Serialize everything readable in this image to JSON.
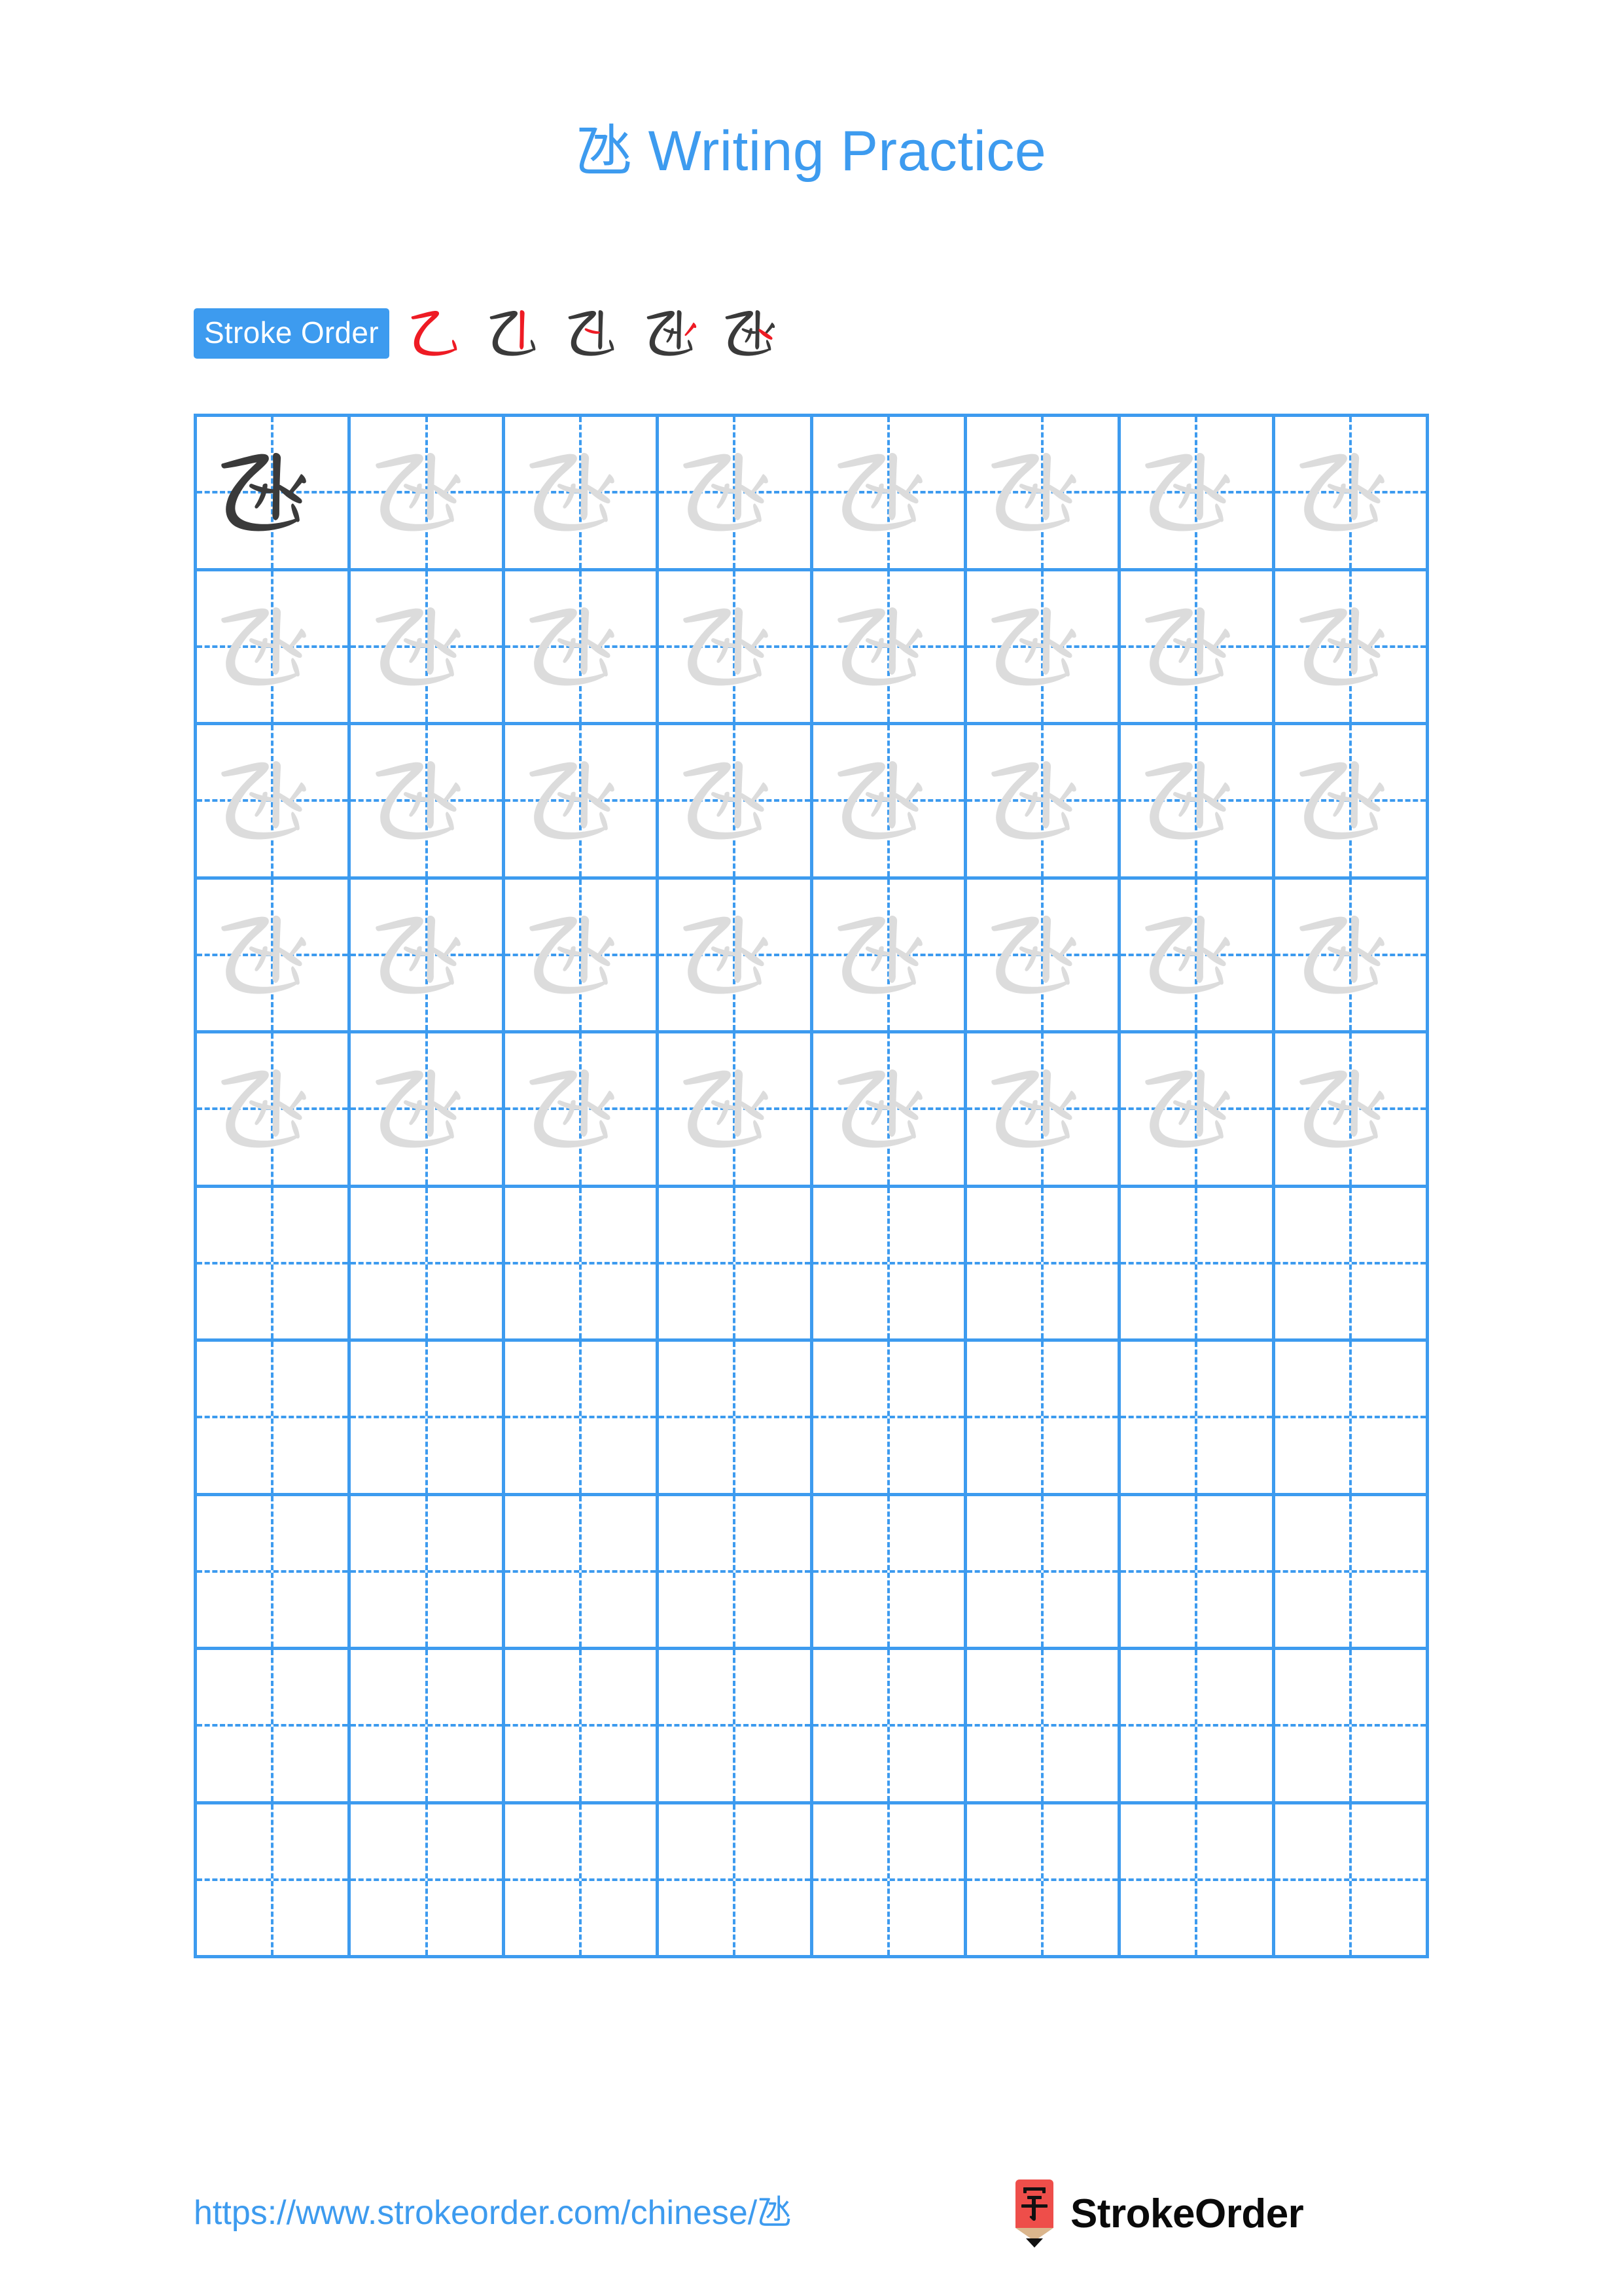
{
  "page": {
    "character": "氹",
    "background_color": "#ffffff",
    "accent_color": "#3d9bef",
    "guide_char_color": "#dcdcdc",
    "ink_color": "#3a3a3a",
    "highlight_stroke_color": "#ee1b24"
  },
  "title": {
    "character": "氹",
    "text": " Writing Practice",
    "full": "氹 Writing Practice",
    "color": "#3d9bef"
  },
  "stroke_order": {
    "label": "Stroke Order",
    "badge_background": "#3d9bef",
    "badge_text_color": "#ffffff",
    "total_strokes": 5,
    "steps": [
      {
        "index": 1,
        "strokes_shown": 1,
        "new_stroke": "乙 (héngzhéwāngōu)",
        "glyph": "乙"
      },
      {
        "index": 2,
        "strokes_shown": 2,
        "new_stroke": "丨 (shù)",
        "glyph": "氹-2"
      },
      {
        "index": 3,
        "strokes_shown": 3,
        "new_stroke": "㇀ (tí)",
        "glyph": "氹-3"
      },
      {
        "index": 4,
        "strokes_shown": 4,
        "new_stroke": "丿 (piě)",
        "glyph": "氹-4"
      },
      {
        "index": 5,
        "strokes_shown": 5,
        "new_stroke": "㇏ (nà)",
        "glyph": "氹"
      }
    ]
  },
  "grid": {
    "columns": 8,
    "rows": 10,
    "border_color": "#3d9bef",
    "guide_line_style": "dashed",
    "guide_char_rows": 5,
    "empty_rows": 5,
    "dark_cells": [
      {
        "row": 1,
        "col": 1
      }
    ],
    "cell_character": "氹"
  },
  "footer": {
    "url": "https://www.strokeorder.com/chinese/氹",
    "url_color": "#3d9bef",
    "brand": "StrokeOrder",
    "logo": {
      "name": "pencil-logo",
      "body_color": "#ee4e4a",
      "tip_color": "#dbb68d",
      "point_color": "#111111",
      "glyph": "字"
    }
  }
}
